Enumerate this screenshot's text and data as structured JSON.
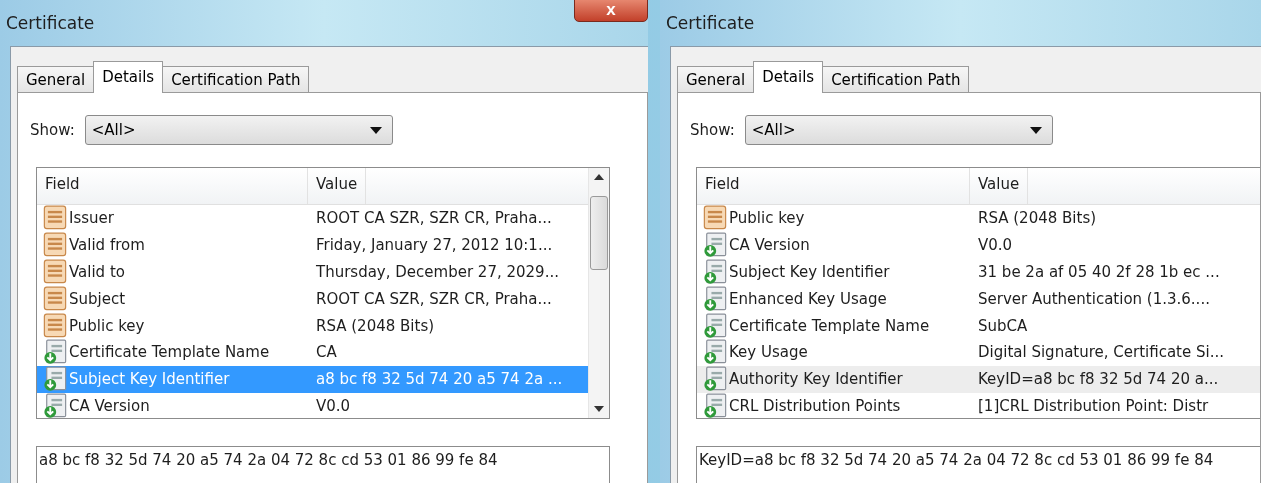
{
  "windows": [
    {
      "title": "Certificate",
      "close": "x",
      "list_focused": true,
      "tabs": [
        {
          "label": "General",
          "selected": false
        },
        {
          "label": "Details",
          "selected": true
        },
        {
          "label": "Certification Path",
          "selected": false
        }
      ],
      "show_label": "Show:",
      "show_value": "<All>",
      "columns": [
        "Field",
        "Value"
      ],
      "rows": [
        {
          "kind": "cert",
          "field": "Issuer",
          "value": "ROOT CA SZR, SZR CR, Praha...",
          "selected": false
        },
        {
          "kind": "cert",
          "field": "Valid from",
          "value": "Friday, January 27, 2012 10:1...",
          "selected": false
        },
        {
          "kind": "cert",
          "field": "Valid to",
          "value": "Thursday, December 27, 2029...",
          "selected": false
        },
        {
          "kind": "cert",
          "field": "Subject",
          "value": "ROOT CA SZR, SZR CR, Praha...",
          "selected": false
        },
        {
          "kind": "cert",
          "field": "Public key",
          "value": "RSA (2048 Bits)",
          "selected": false
        },
        {
          "kind": "ext",
          "field": "Certificate Template Name",
          "value": "CA",
          "selected": false
        },
        {
          "kind": "ext",
          "field": "Subject Key Identifier",
          "value": "a8 bc f8 32 5d 74 20 a5 74 2a ...",
          "selected": true
        },
        {
          "kind": "ext",
          "field": "CA Version",
          "value": "V0.0",
          "selected": false
        }
      ],
      "detail": "a8 bc f8 32 5d 74 20 a5 74 2a 04 72 8c cd 53 01 86 99 fe 84"
    },
    {
      "title": "Certificate",
      "list_focused": false,
      "tabs": [
        {
          "label": "General",
          "selected": false
        },
        {
          "label": "Details",
          "selected": true
        },
        {
          "label": "Certification Path",
          "selected": false
        }
      ],
      "show_label": "Show:",
      "show_value": "<All>",
      "columns": [
        "Field",
        "Value"
      ],
      "rows": [
        {
          "kind": "cert",
          "field": "Public key",
          "value": "RSA (2048 Bits)",
          "selected": false
        },
        {
          "kind": "ext",
          "field": "CA Version",
          "value": "V0.0",
          "selected": false
        },
        {
          "kind": "ext",
          "field": "Subject Key Identifier",
          "value": "31 be 2a af 05 40 2f 28 1b ec ...",
          "selected": false
        },
        {
          "kind": "ext",
          "field": "Enhanced Key Usage",
          "value": "Server Authentication (1.3.6....",
          "selected": false
        },
        {
          "kind": "ext",
          "field": "Certificate Template Name",
          "value": "SubCA",
          "selected": false
        },
        {
          "kind": "ext",
          "field": "Key Usage",
          "value": "Digital Signature, Certificate Si...",
          "selected": false
        },
        {
          "kind": "ext",
          "field": "Authority Key Identifier",
          "value": "KeyID=a8 bc f8 32 5d 74 20 a...",
          "selected": true
        },
        {
          "kind": "ext",
          "field": "CRL Distribution Points",
          "value": "[1]CRL Distribution Point: Distr",
          "selected": false
        }
      ],
      "detail": "KeyID=a8 bc f8 32 5d 74 20 a5 74 2a 04 72 8c cd 53 01 86 99 fe 84"
    }
  ]
}
